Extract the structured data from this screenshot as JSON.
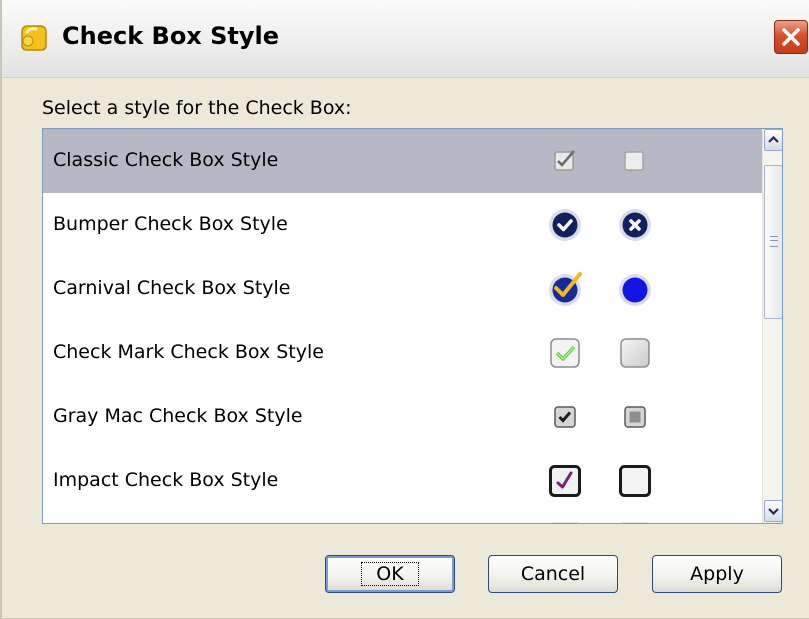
{
  "dialog": {
    "title": "Check Box Style",
    "prompt": "Select a style for the Check Box:"
  },
  "styles": [
    {
      "label": "Classic Check Box Style",
      "selected": true
    },
    {
      "label": "Bumper Check Box Style",
      "selected": false
    },
    {
      "label": "Carnival Check Box Style",
      "selected": false
    },
    {
      "label": "Check Mark Check Box Style",
      "selected": false
    },
    {
      "label": "Gray Mac Check Box Style",
      "selected": false
    },
    {
      "label": "Impact Check Box Style",
      "selected": false
    }
  ],
  "buttons": {
    "ok": "OK",
    "cancel": "Cancel",
    "apply": "Apply"
  },
  "colors": {
    "selected_row": "#b6b9c5",
    "close_button": "#d8512f",
    "list_border": "#7f9db9"
  },
  "icons": [
    "app-icon",
    "close-icon",
    "scroll-up-icon",
    "scroll-down-icon"
  ]
}
